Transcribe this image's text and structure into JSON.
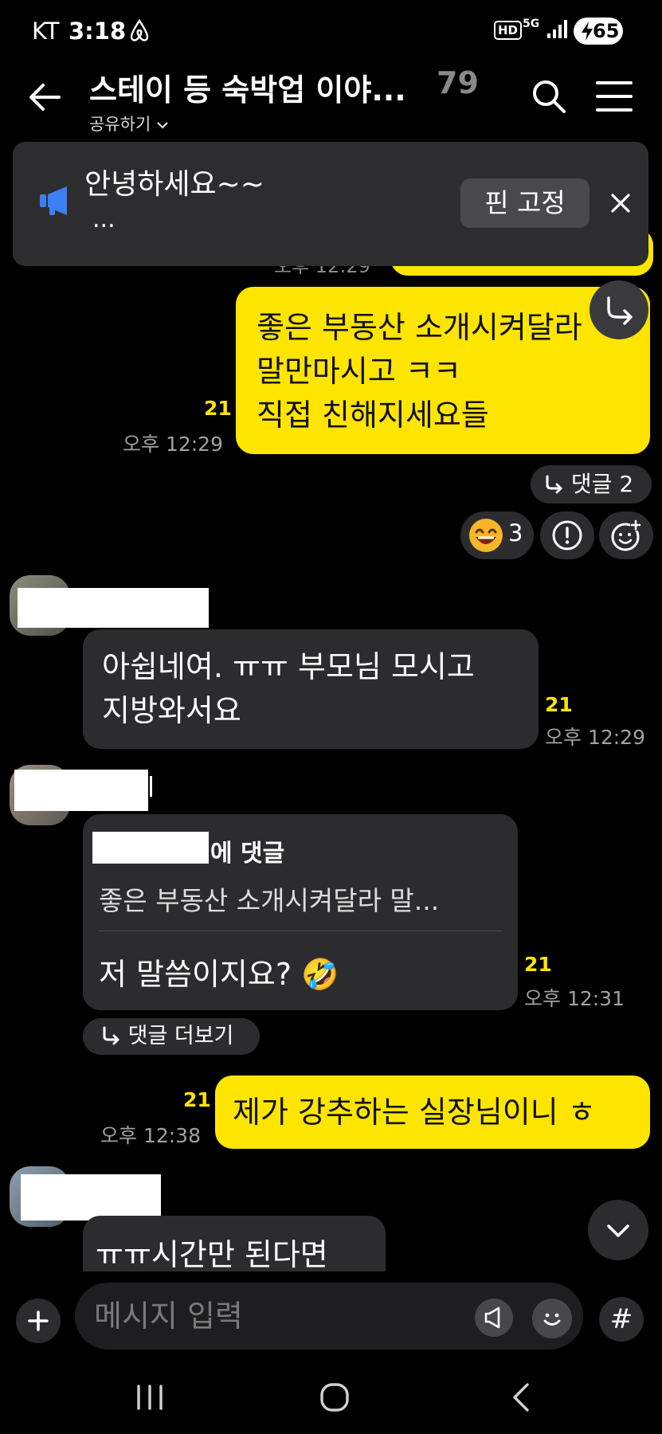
{
  "status_bar": {
    "carrier": "KT",
    "time": "3:18",
    "network_hd": "HD",
    "network_5g": "5G",
    "battery": "65"
  },
  "header": {
    "title": "스테이 등 숙박업 이야...",
    "member_count": "79",
    "share_label": "공유하기",
    "icons": [
      "back-arrow-icon",
      "search-icon",
      "menu-icon"
    ]
  },
  "notice": {
    "text": "안녕하세요~~",
    "more": "...",
    "pin_label": "핀 고정"
  },
  "previous_message": {
    "time": "오후 12:29"
  },
  "messages": [
    {
      "side": "me",
      "lines": [
        "좋은 부동산 소개시켜달라",
        "말만마시고 ㅋㅋ",
        "직접 친해지세요들"
      ],
      "unread": "21",
      "time": "오후 12:29",
      "reply_chip": "댓글 2",
      "reaction_count": "3"
    },
    {
      "side": "other",
      "lines": [
        "아쉽네여. ㅠㅠ 부모님 모시고",
        "지방와서요"
      ],
      "unread": "21",
      "time": "오후 12:29"
    },
    {
      "side": "other",
      "quote_header": "에 댓글",
      "quote_text": "좋은 부동산 소개시켜달라  말...",
      "text": "저 말씀이지요? 🤣",
      "unread": "21",
      "time": "오후 12:31",
      "more_chip": "댓글 더보기"
    },
    {
      "side": "me",
      "text": "제가 강추하는 실장님이니 ㅎ",
      "unread": "21",
      "time": "오후 12:38"
    },
    {
      "side": "other",
      "text": "ㅠㅠ시간만 된다면"
    }
  ],
  "input": {
    "placeholder": "메시지 입력",
    "hash": "#"
  },
  "colors": {
    "my_bubble": "#fee500",
    "other_bubble": "#2c2c2e",
    "unread": "#fee500",
    "background": "#000000"
  }
}
